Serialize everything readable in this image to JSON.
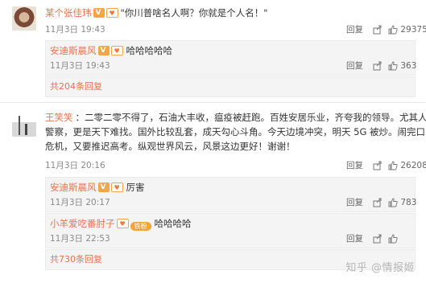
{
  "comments": [
    {
      "author": "某个张佳玮",
      "text": "\"你川普啥名人啊？你就是个人名！\"",
      "time": "11月3日 19:43",
      "reply_label": "回复",
      "likes": "29375",
      "reply": {
        "author": "安迪斯晨风",
        "text": "哈哈哈哈哈",
        "time": "11月3日 19:43",
        "reply_label": "回复",
        "likes": "363"
      },
      "more_replies": "共204条回复"
    },
    {
      "author": "王笑笑",
      "text_lines": [
        "二零二零不得了，石油大丰收，瘟疫被赶跑。百姓安居乐业，齐夸我的领导。尤其人民",
        "警察，更是天下难找。国外比较乱套，成天勾心斗角。今天边境冲突，明天 5G 被炒。闹完口罩",
        "危机，又要推迟高考。纵观世界风云，风景这边更好！谢谢！"
      ],
      "time": "11月3日 20:16",
      "reply_label": "回复",
      "likes": "26208",
      "replies": [
        {
          "author": "安迪斯晨风",
          "text": "厉害",
          "time": "11月3日 20:17",
          "reply_label": "回复",
          "likes": "783"
        },
        {
          "author": "小羊爱吃番肘子",
          "fan_badge": "铁粉",
          "text": "哈哈哈哈",
          "time": "11月3日 22:53",
          "reply_label": "回复",
          "likes": ""
        }
      ],
      "more_replies": "共730条回复"
    }
  ],
  "watermark": "知乎 @情报姬",
  "colors": {
    "name": "#eb7350",
    "meta": "#8a8a8a",
    "box_bg": "#f4f4f4"
  },
  "icons": [
    "share-icon",
    "like-icon",
    "verified-badge",
    "level-badge"
  ]
}
